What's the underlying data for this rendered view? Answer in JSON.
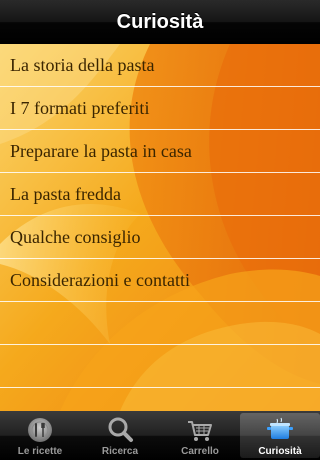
{
  "navbar": {
    "title": "Curiosità"
  },
  "list": {
    "items": [
      {
        "label": "La storia della pasta"
      },
      {
        "label": "I 7 formati preferiti"
      },
      {
        "label": "Preparare la pasta in casa"
      },
      {
        "label": "La pasta fredda"
      },
      {
        "label": "Qualche consiglio"
      },
      {
        "label": "Considerazioni e contatti"
      }
    ]
  },
  "tabbar": {
    "tabs": [
      {
        "label": "Le ricette",
        "icon": "plate-fork-knife-icon"
      },
      {
        "label": "Ricerca",
        "icon": "magnifier-icon"
      },
      {
        "label": "Carrello",
        "icon": "cart-icon"
      },
      {
        "label": "Curiosità",
        "icon": "pot-icon",
        "selected": true
      }
    ]
  },
  "colors": {
    "background": "#f4a315",
    "row_text": "#3a2500",
    "active_icon": "#3aa0ff"
  }
}
